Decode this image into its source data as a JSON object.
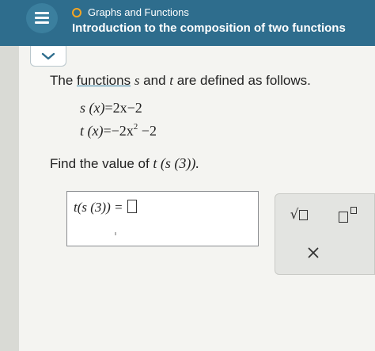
{
  "header": {
    "topic": "Graphs and Functions",
    "title": "Introduction to the composition of two functions"
  },
  "problem": {
    "intro_prefix": "The ",
    "intro_link": "functions",
    "intro_s": "s",
    "intro_and": " and ",
    "intro_t": "t",
    "intro_suffix": " are defined as follows.",
    "eq_s": {
      "lhs": "s (x)",
      "rhs": "=2x−2"
    },
    "eq_t": {
      "lhs": "t (x)",
      "rhs_prefix": "=−2x",
      "exponent": "2",
      "rhs_suffix": " −2"
    },
    "find_prefix": "Find the value of ",
    "find_expr": "t (s (3)).",
    "answer_expr": "t(s (3)) ="
  },
  "colors": {
    "header": "#2e6d8d",
    "topic_dot": "#f6a623",
    "link_underline": "#2f7ea3"
  }
}
